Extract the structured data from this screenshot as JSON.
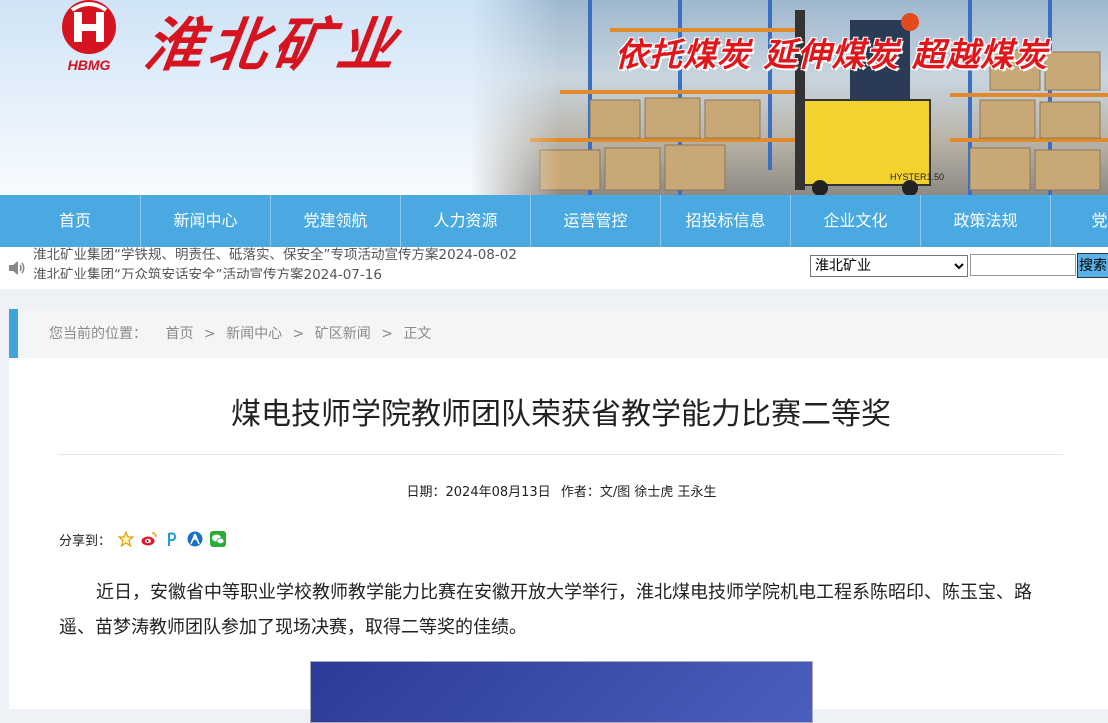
{
  "header": {
    "logo_text": "HBMG",
    "brand": "淮北矿业",
    "slogan": "依托煤炭  延伸煤炭  超越煤炭",
    "photo_label": "HYSTER1.50"
  },
  "nav": {
    "items": [
      "首页",
      "新闻中心",
      "党建领航",
      "人力资源",
      "运营管控",
      "招投标信息",
      "企业文化",
      "政策法规",
      "党纪学"
    ]
  },
  "notice": {
    "items": [
      "淮北矿业集团“学铁规、明责任、砥落实、保安全”专项活动宣传方案2024-08-02",
      "淮北矿业集团“万众筑安话安全”活动宣传方案2024-07-16"
    ],
    "site_select": "淮北矿业",
    "search_placeholder": "",
    "search_button": "搜索"
  },
  "breadcrumb": {
    "lead": "您当前的位置：",
    "items": [
      "首页",
      "新闻中心",
      "矿区新闻",
      "正文"
    ],
    "separator": ">"
  },
  "article": {
    "title": "煤电技师学院教师团队荣获省教学能力比赛二等奖",
    "date_label": "日期：2024年08月13日",
    "author_label": "作者：文/图 徐士虎 王永生",
    "share_label": "分享到：",
    "share_icons": [
      "star-icon",
      "weibo-icon",
      "pengyou-icon",
      "renren-icon",
      "wechat-icon"
    ],
    "paragraph": "近日，安徽省中等职业学校教师教学能力比赛在安徽开放大学举行，淮北煤电技师学院机电工程系陈昭印、陈玉宝、路遥、苗梦涛教师团队参加了现场决赛，取得二等奖的佳绩。"
  },
  "colors": {
    "nav_bg": "#4aa9e0",
    "brand_red": "#d6141f",
    "accent_bar": "#3fa3dc"
  }
}
